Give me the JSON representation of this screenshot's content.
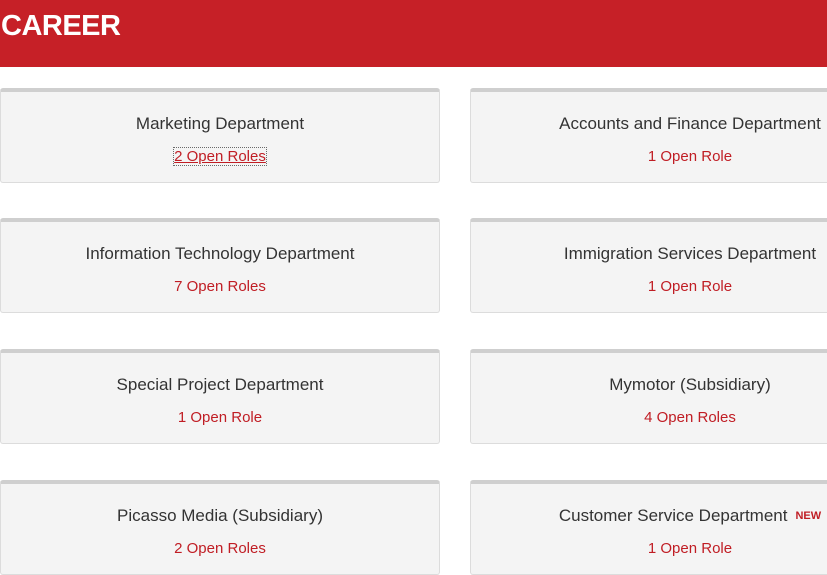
{
  "header": {
    "title": "CAREER",
    "background_color": "#c62027"
  },
  "departments": [
    {
      "name": "Marketing Department",
      "roles": "2 Open Roles"
    },
    {
      "name": "Accounts and Finance Department",
      "roles": "1 Open Role"
    },
    {
      "name": "Information Technology Department",
      "roles": "7 Open Roles"
    },
    {
      "name": "Immigration Services Department",
      "roles": "1 Open Role"
    },
    {
      "name": "Special Project Department",
      "roles": "1 Open Role"
    },
    {
      "name": "Mymotor (Subsidiary)",
      "roles": "4 Open Roles"
    },
    {
      "name": "Picasso Media (Subsidiary)",
      "roles": "2 Open Roles"
    },
    {
      "name": "Customer Service Department",
      "roles": "1 Open Role",
      "badge": "NEW"
    }
  ],
  "colors": {
    "accent": "#c01d24",
    "card_background": "#f4f4f4",
    "text": "#333333"
  }
}
